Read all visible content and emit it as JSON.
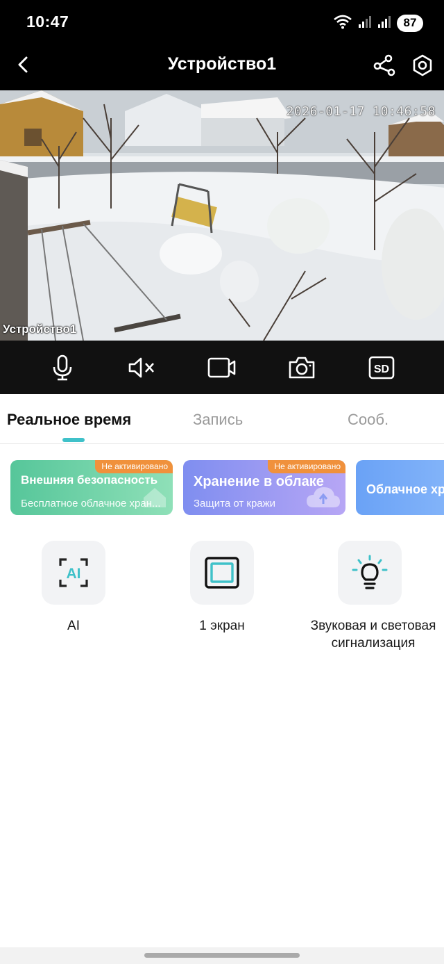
{
  "status_bar": {
    "time": "10:47",
    "battery": "87",
    "icons": [
      "wifi-icon",
      "signal-icon",
      "signal-icon"
    ]
  },
  "header": {
    "title": "Устройство1",
    "icons": [
      "back-arrow-icon",
      "share-icon",
      "settings-icon"
    ]
  },
  "video": {
    "timestamp": "2026-01-17 10:46:58",
    "device_label": "Устройство1"
  },
  "controls": {
    "icons": [
      "microphone-icon",
      "mute-icon",
      "record-video-icon",
      "camera-icon",
      "sd-icon"
    ],
    "sd_label": "SD"
  },
  "tabs": [
    {
      "label": "Реальное время",
      "active": true
    },
    {
      "label": "Запись",
      "active": false
    },
    {
      "label": "Сооб.",
      "active": false
    }
  ],
  "cards": [
    {
      "badge": "Не активировано",
      "title": "Внешняя безопасность",
      "subtitle": "Бесплатное облачное хран...",
      "color": "#5dcf9e"
    },
    {
      "badge": "Не активировано",
      "title": "Хранение в облаке",
      "subtitle": "Защита от кражи",
      "color": "#8b9cf2"
    },
    {
      "title": "Облачное хр",
      "color": "#6f9df5"
    }
  ],
  "features": [
    {
      "label": "AI",
      "icon": "ai-icon"
    },
    {
      "label": "1 экран",
      "icon": "single-screen-icon"
    },
    {
      "label": "Звуковая и световая сигнализация",
      "icon": "alarm-light-icon"
    }
  ],
  "colors": {
    "accent": "#3fc1c9",
    "badge": "#f0913c"
  }
}
